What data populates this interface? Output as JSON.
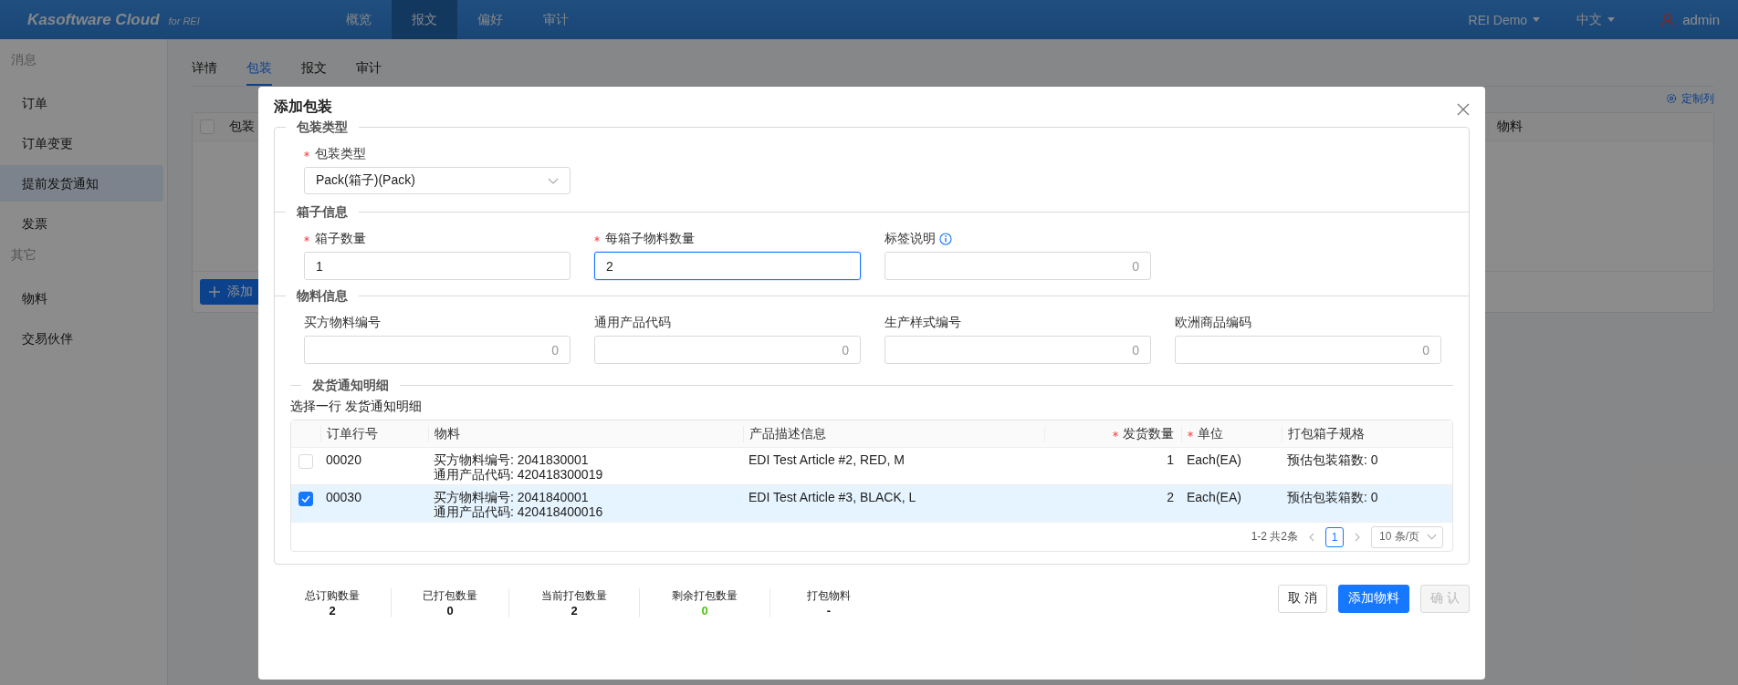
{
  "topbar": {
    "brand": "Kasoftware Cloud",
    "brand_suffix": "for REI",
    "nav": [
      {
        "label": "概览",
        "selected": false
      },
      {
        "label": "报文",
        "selected": true
      },
      {
        "label": "偏好",
        "selected": false
      },
      {
        "label": "审计",
        "selected": false
      }
    ],
    "tenant": "REI Demo",
    "language": "中文",
    "user": "admin"
  },
  "sidebar": [
    {
      "title": "消息",
      "items": [
        {
          "label": "订单",
          "selected": false
        },
        {
          "label": "订单变更",
          "selected": false
        },
        {
          "label": "提前发货通知",
          "selected": true
        },
        {
          "label": "发票",
          "selected": false
        }
      ]
    },
    {
      "title": "其它",
      "items": [
        {
          "label": "物料",
          "selected": false
        },
        {
          "label": "交易伙伴",
          "selected": false
        }
      ]
    }
  ],
  "tabs": [
    {
      "label": "详情",
      "selected": false
    },
    {
      "label": "包装",
      "selected": true
    },
    {
      "label": "报文",
      "selected": false
    },
    {
      "label": "审计",
      "selected": false
    }
  ],
  "background_table": {
    "customize_link": "定制列",
    "header_checked": false,
    "columns": [
      "包装",
      "物料"
    ],
    "add_button": "添加"
  },
  "dialog": {
    "title": "添加包装",
    "sections": [
      {
        "legend": "包装类型",
        "fields": [
          {
            "kind": "select",
            "label": "包装类型",
            "required": true,
            "value": "Pack(箱子)(Pack)"
          }
        ]
      },
      {
        "legend": "箱子信息",
        "fields": [
          {
            "kind": "input",
            "label": "箱子数量",
            "required": true,
            "value": "1",
            "focused": false
          },
          {
            "kind": "input",
            "label": "每箱子物料数量",
            "required": true,
            "value": "2",
            "focused": true
          },
          {
            "kind": "number",
            "label": "标签说明",
            "required": false,
            "info": true,
            "placeholder": "0"
          }
        ]
      },
      {
        "legend": "物料信息",
        "fields": [
          {
            "kind": "number",
            "label": "买方物料编号",
            "required": false,
            "placeholder": "0"
          },
          {
            "kind": "number",
            "label": "通用产品代码",
            "required": false,
            "placeholder": "0"
          },
          {
            "kind": "number",
            "label": "生产样式编号",
            "required": false,
            "placeholder": "0"
          },
          {
            "kind": "number",
            "label": "欧洲商品编码",
            "required": false,
            "placeholder": "0"
          }
        ]
      }
    ],
    "detail": {
      "legend": "发货通知明细",
      "hint": "选择一行 发货通知明细",
      "columns": [
        {
          "label": "订单行号",
          "required": false,
          "kind": "text"
        },
        {
          "label": "物料",
          "required": false,
          "kind": "text"
        },
        {
          "label": "产品描述信息",
          "required": false,
          "kind": "text"
        },
        {
          "label": "发货数量",
          "required": true,
          "kind": "numeric"
        },
        {
          "label": "单位",
          "required": true,
          "kind": "text"
        },
        {
          "label": "打包箱子规格",
          "required": false,
          "kind": "text"
        }
      ],
      "rows": [
        {
          "selected": false,
          "line": "00020",
          "material": [
            "买方物料编号: 2041830001",
            "通用产品代码: 420418300019"
          ],
          "description": "EDI Test Article #2, RED, M",
          "quantity": "1",
          "unit": "Each(EA)",
          "box_spec": "预估包装箱数: 0"
        },
        {
          "selected": true,
          "line": "00030",
          "material": [
            "买方物料编号: 2041840001",
            "通用产品代码: 420418400016"
          ],
          "description": "EDI Test Article #3, BLACK, L",
          "quantity": "2",
          "unit": "Each(EA)",
          "box_spec": "预估包装箱数: 0"
        }
      ],
      "pagination": {
        "total": "1-2 共2条",
        "page": "1",
        "page_size": "10 条/页"
      }
    },
    "stats": [
      {
        "label": "总订购数量",
        "value": "2",
        "kind": "plain"
      },
      {
        "label": "已打包数量",
        "value": "0",
        "kind": "plain"
      },
      {
        "label": "当前打包数量",
        "value": "2",
        "kind": "plain"
      },
      {
        "label": "剩余打包数量",
        "value": "0",
        "kind": "success"
      },
      {
        "label": "打包物料",
        "value": "-",
        "kind": "plain"
      }
    ],
    "buttons": [
      {
        "label": "取 消",
        "kind": "default",
        "disabled": false
      },
      {
        "label": "添加物料",
        "kind": "primary",
        "disabled": false
      },
      {
        "label": "确 认",
        "kind": "default",
        "disabled": true
      }
    ]
  }
}
